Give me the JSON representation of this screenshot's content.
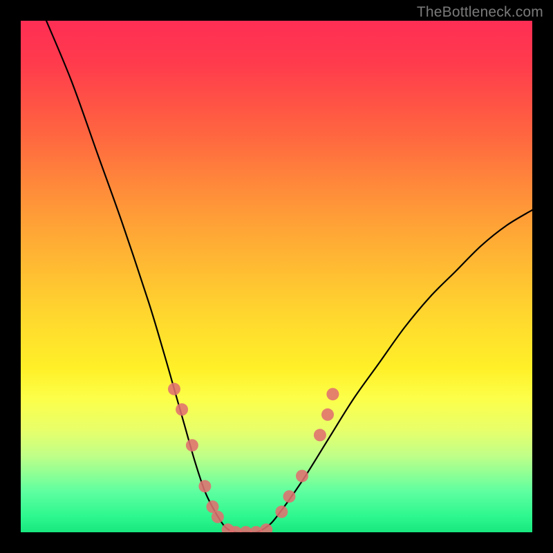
{
  "watermark": "TheBottleneck.com",
  "chart_data": {
    "type": "line",
    "title": "",
    "xlabel": "",
    "ylabel": "",
    "xlim": [
      0,
      100
    ],
    "ylim": [
      0,
      100
    ],
    "grid": false,
    "legend": false,
    "series": [
      {
        "name": "bottleneck-curve",
        "x": [
          5,
          10,
          15,
          20,
          25,
          28,
          30,
          32,
          34,
          36,
          38,
          40,
          42,
          44,
          46,
          48,
          50,
          55,
          60,
          65,
          70,
          75,
          80,
          85,
          90,
          95,
          100
        ],
        "y": [
          100,
          88,
          74,
          60,
          45,
          35,
          28,
          21,
          14,
          8,
          4,
          1,
          0,
          0,
          0,
          1,
          3,
          10,
          18,
          26,
          33,
          40,
          46,
          51,
          56,
          60,
          63
        ]
      }
    ],
    "markers": {
      "name": "highlight-points",
      "color": "#e0706f",
      "radius": 9,
      "points": [
        {
          "x": 30.0,
          "y": 28
        },
        {
          "x": 31.5,
          "y": 24
        },
        {
          "x": 33.5,
          "y": 17
        },
        {
          "x": 36.0,
          "y": 9
        },
        {
          "x": 37.5,
          "y": 5
        },
        {
          "x": 38.5,
          "y": 3
        },
        {
          "x": 40.5,
          "y": 0.5
        },
        {
          "x": 42.0,
          "y": 0
        },
        {
          "x": 44.0,
          "y": 0
        },
        {
          "x": 46.0,
          "y": 0
        },
        {
          "x": 48.0,
          "y": 0.5
        },
        {
          "x": 51.0,
          "y": 4
        },
        {
          "x": 52.5,
          "y": 7
        },
        {
          "x": 55.0,
          "y": 11
        },
        {
          "x": 58.5,
          "y": 19
        },
        {
          "x": 60.0,
          "y": 23
        },
        {
          "x": 61.0,
          "y": 27
        }
      ]
    }
  }
}
